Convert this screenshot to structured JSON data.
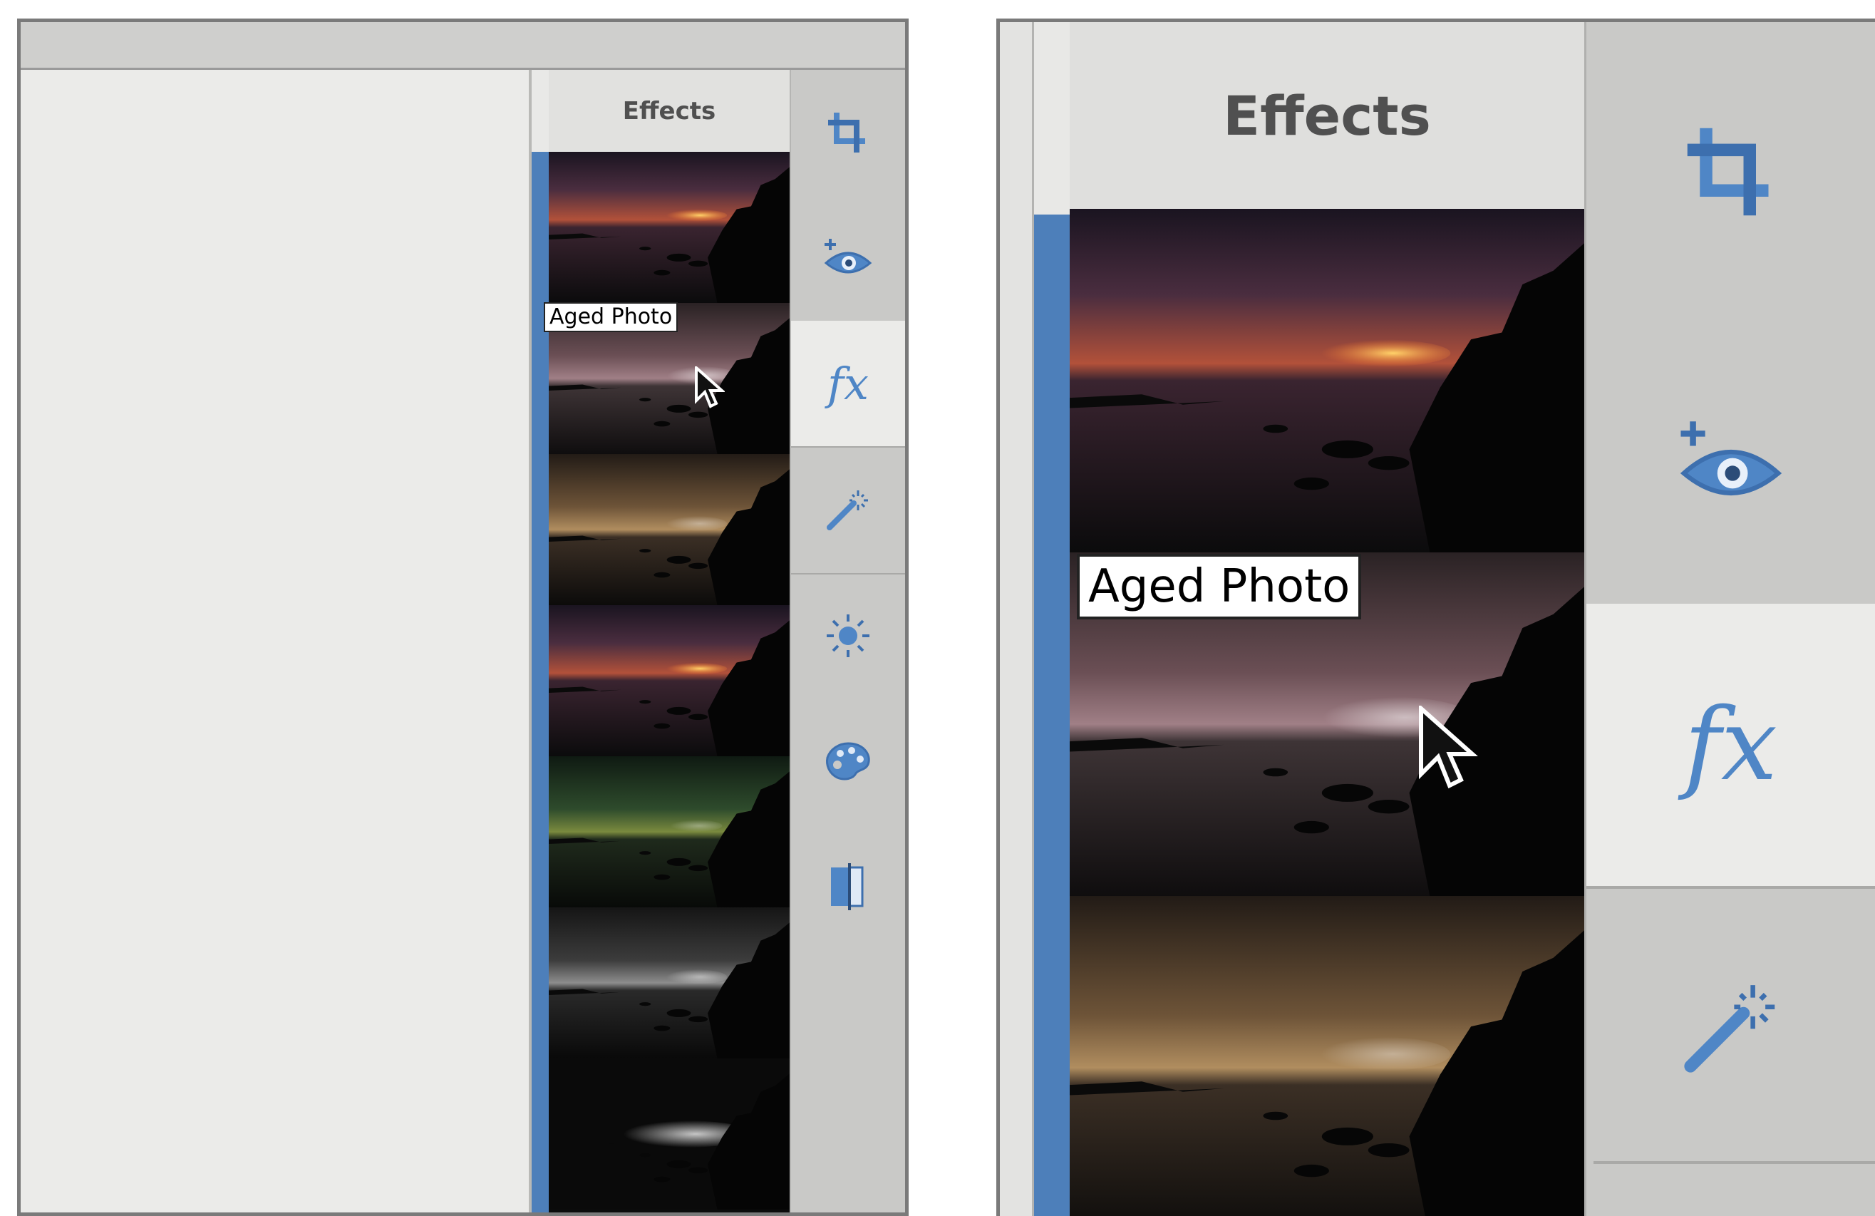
{
  "left_panel": {
    "panel_title": "Effects",
    "hovered_effect_tooltip": "Aged Photo",
    "tools": [
      {
        "icon": "crop-icon"
      },
      {
        "icon": "red-eye-icon"
      },
      {
        "icon": "fx-icon",
        "label": "fx",
        "active": true
      },
      {
        "icon": "magic-wand-icon"
      },
      {
        "icon": "brightness-icon"
      },
      {
        "icon": "palette-icon"
      },
      {
        "icon": "straighten-icon"
      }
    ]
  },
  "right_panel": {
    "panel_title": "Effects",
    "hovered_effect_tooltip": "Aged Photo",
    "tools": [
      {
        "icon": "crop-icon"
      },
      {
        "icon": "red-eye-icon"
      },
      {
        "icon": "fx-icon",
        "label": "fx",
        "active": true
      },
      {
        "icon": "magic-wand-icon"
      }
    ]
  },
  "colors": {
    "accent_blue": "#4d7fba",
    "icon_blue": "#4f86c6",
    "panel_gray": "#c9c9c7"
  }
}
